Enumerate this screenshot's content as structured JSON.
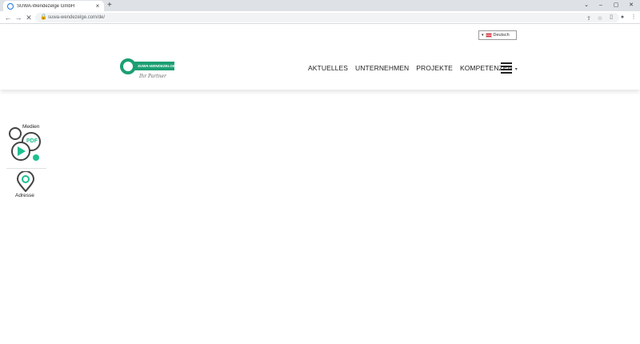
{
  "browser": {
    "tab_title": "SUWA-Wendezelge GmbH",
    "tab_close": "×",
    "new_tab": "+",
    "url": "suwa-wendezelge.com/de/",
    "window": {
      "chevron": "⌄",
      "minimize": "–",
      "restore": "▢",
      "close": "✕"
    },
    "nav": {
      "back": "←",
      "forward": "→",
      "reload": "✕"
    },
    "lock": "🔒",
    "toolbar_icons": {
      "share": "⇪",
      "star": "☆",
      "sidebar": "▯",
      "user": "●",
      "menu": "⋮"
    }
  },
  "header": {
    "language": {
      "label": "Deutsch",
      "caret": "▾"
    },
    "logo": {
      "wordmark": "SUWA-WENDEZELGE",
      "signature": "Ihr Partner"
    },
    "nav": [
      {
        "label": "AKTUELLES"
      },
      {
        "label": "UNTERNEHMEN"
      },
      {
        "label": "PROJEKTE"
      },
      {
        "label": "KOMPETENZEN",
        "dropdown": "▾"
      }
    ]
  },
  "sidebar_widget": {
    "medien": {
      "label": "Medien",
      "pdf": "PDF"
    },
    "adresse": {
      "label": "Adresse"
    }
  },
  "colors": {
    "brand_green": "#1c9f72",
    "icon_dark": "#444444",
    "accent_teal": "#1dbf8f"
  }
}
